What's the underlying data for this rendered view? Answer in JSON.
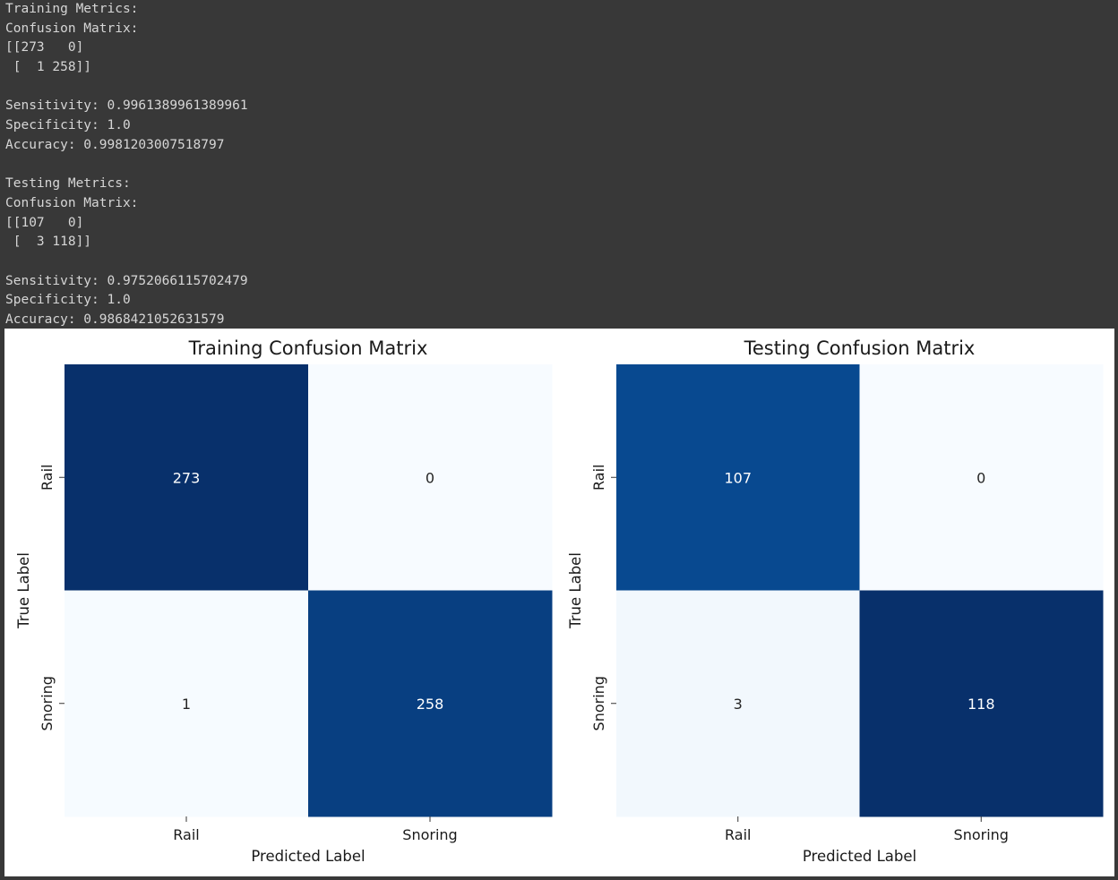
{
  "console": {
    "lines": [
      "Training Metrics:",
      "Confusion Matrix:",
      "[[273   0]",
      " [  1 258]]",
      "",
      "Sensitivity: 0.9961389961389961",
      "Specificity: 1.0",
      "Accuracy: 0.9981203007518797",
      "",
      "Testing Metrics:",
      "Confusion Matrix:",
      "[[107   0]",
      " [  3 118]]",
      "",
      "Sensitivity: 0.9752066115702479",
      "Specificity: 1.0",
      "Accuracy: 0.9868421052631579"
    ]
  },
  "chart_data": [
    {
      "type": "heatmap",
      "title": "Training Confusion Matrix",
      "xlabel": "Predicted Label",
      "ylabel": "True Label",
      "x_categories": [
        "Rail",
        "Snoring"
      ],
      "y_categories": [
        "Rail",
        "Snoring"
      ],
      "values": [
        [
          273,
          0
        ],
        [
          1,
          258
        ]
      ],
      "colormap": "Blues",
      "colorbar": false
    },
    {
      "type": "heatmap",
      "title": "Testing Confusion Matrix",
      "xlabel": "Predicted Label",
      "ylabel": "True Label",
      "x_categories": [
        "Rail",
        "Snoring"
      ],
      "y_categories": [
        "Rail",
        "Snoring"
      ],
      "values": [
        [
          107,
          0
        ],
        [
          3,
          118
        ]
      ],
      "colormap": "Blues",
      "colorbar": false
    }
  ],
  "colors": {
    "console_bg": "#383838",
    "console_text": "#d6d6d6",
    "figure_bg": "#ffffff",
    "blues_low": "#f7fbff",
    "blues_high": "#08306b"
  }
}
